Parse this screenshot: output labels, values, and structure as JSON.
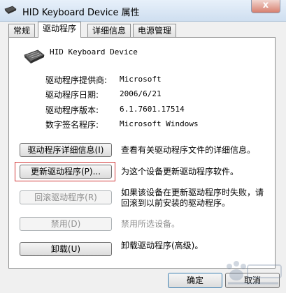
{
  "window": {
    "title": "HID Keyboard Device 属性",
    "close_label": "x"
  },
  "tabs": [
    {
      "label": "常规"
    },
    {
      "label": "驱动程序"
    },
    {
      "label": "详细信息"
    },
    {
      "label": "电源管理"
    }
  ],
  "device": {
    "name": "HID Keyboard Device",
    "icon": "keyboard-icon"
  },
  "info": [
    {
      "label": "驱动程序提供商:",
      "value": "Microsoft"
    },
    {
      "label": "驱动程序日期:",
      "value": "2006/6/21"
    },
    {
      "label": "驱动程序版本:",
      "value": "6.1.7601.17514"
    },
    {
      "label": "数字签名程序:",
      "value": "Microsoft Windows"
    }
  ],
  "actions": [
    {
      "button": "驱动程序详细信息(I)",
      "description": "查看有关驱动程序文件的详细信息。",
      "enabled": true
    },
    {
      "button": "更新驱动程序(P)...",
      "description": "为这个设备更新驱动程序软件。",
      "enabled": true
    },
    {
      "button": "回滚驱动程序(R)",
      "description": "如果该设备在更新驱动程序时失败，请回滚到以前安装的驱动程序。",
      "enabled": false
    },
    {
      "button": "禁用(D)",
      "description": "禁用所选设备。",
      "enabled": false
    },
    {
      "button": "卸载(U)",
      "description": "卸载驱动程序(高级)。",
      "enabled": true
    }
  ],
  "footer": {
    "ok_label": "确定",
    "cancel_label": "取消"
  },
  "watermark": {
    "icon": "baidu-jingyan-watermark"
  },
  "colors": {
    "highlight_border": "#d23a3a",
    "disabled_text": "#8f8f8f"
  }
}
